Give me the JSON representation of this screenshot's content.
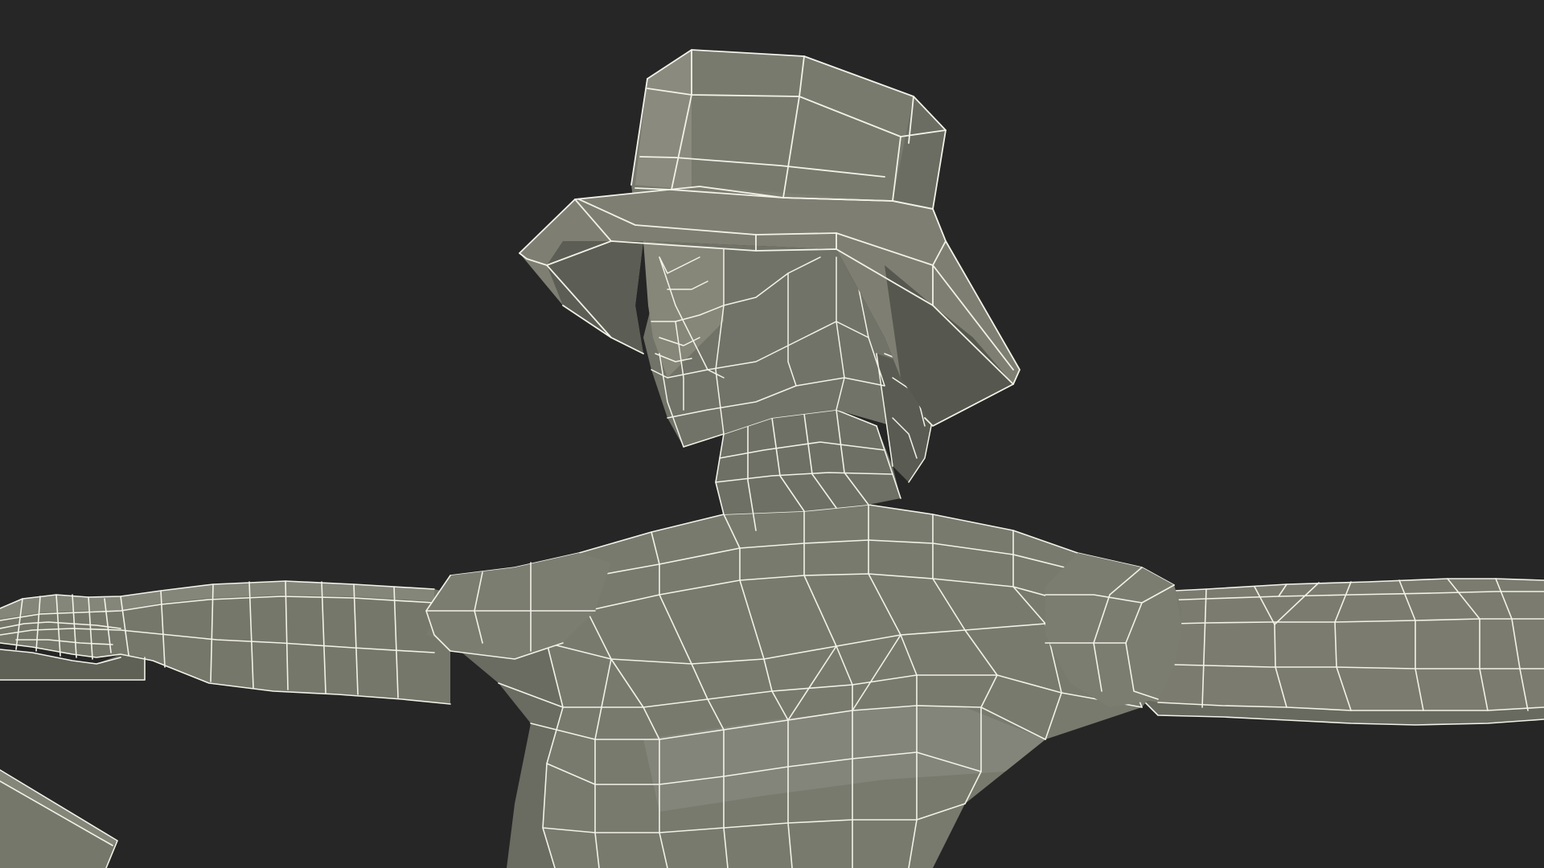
{
  "scene": {
    "subject": "low-poly-human-wireframe-render",
    "colors": {
      "background": "#262626",
      "mesh_surface": "#7b7c6f",
      "mesh_shadow": "#5d5e55",
      "mesh_highlight": "#8c8d80",
      "wire": "#f2f2e8"
    }
  }
}
